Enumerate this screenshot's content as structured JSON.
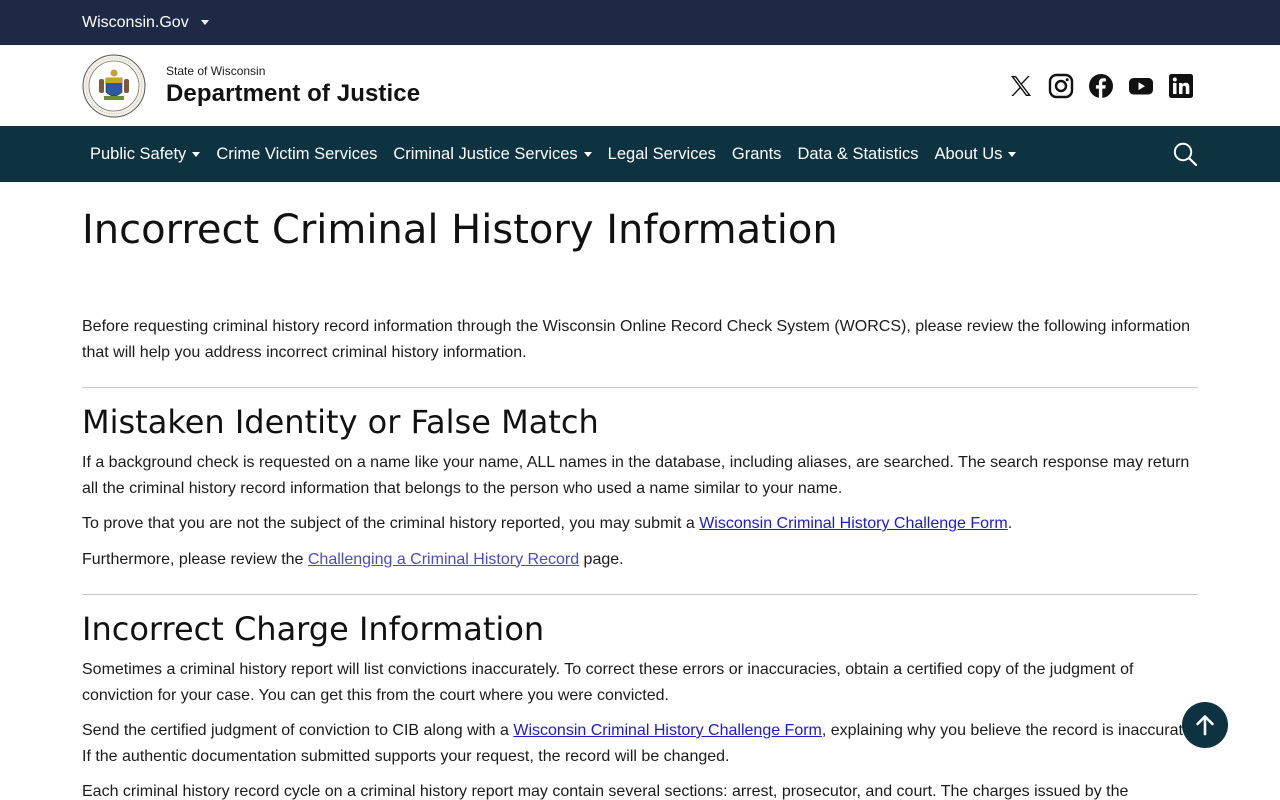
{
  "topbar": {
    "label": "Wisconsin.Gov"
  },
  "header": {
    "state": "State of Wisconsin",
    "department": "Department of Justice",
    "seal_alt": "Wisconsin Department of Justice seal",
    "social": [
      "x-icon",
      "instagram-icon",
      "facebook-icon",
      "youtube-icon",
      "linkedin-icon"
    ]
  },
  "nav": {
    "items": [
      {
        "label": "Public Safety",
        "dropdown": true
      },
      {
        "label": "Crime Victim Services",
        "dropdown": false
      },
      {
        "label": "Criminal Justice Services",
        "dropdown": true
      },
      {
        "label": "Legal Services",
        "dropdown": false
      },
      {
        "label": "Grants",
        "dropdown": false
      },
      {
        "label": "Data & Statistics",
        "dropdown": false
      },
      {
        "label": "About Us",
        "dropdown": true
      }
    ]
  },
  "page": {
    "title": "Incorrect Criminal History Information",
    "intro": "Before requesting criminal history record information through the Wisconsin Online Record Check System (WORCS), please review the following information that will help you address incorrect criminal history information.",
    "sections": [
      {
        "heading": "Mistaken Identity or False Match",
        "p1": "If a background check is requested on a name like your name, ALL names in the database, including aliases, are searched. The search response may return all the criminal history record information that belongs to the person who used a name similar to your name.",
        "p2_before": "To prove that you are not the subject of the criminal history reported, you may submit a ",
        "p2_link": "Wisconsin Criminal History Challenge Form",
        "p2_after": ".",
        "p3_before": "Furthermore, please review the ",
        "p3_link": "Challenging a Criminal History Record",
        "p3_after": " page."
      },
      {
        "heading": "Incorrect Charge Information",
        "p1": "Sometimes a criminal history report will list convictions inaccurately. To correct these errors or inaccuracies, obtain a certified copy of the judgment of conviction for your case. You can get this from the court where you were convicted.",
        "p2_before": "Send the certified judgment of conviction to CIB along with a ",
        "p2_link": "Wisconsin Criminal History Challenge Form",
        "p2_after": ", explaining why you believe the record is inaccurate. If the authentic documentation submitted supports your request, the record will be changed.",
        "p3": "Each criminal history record cycle on a criminal history report may contain several sections: arrest, prosecutor, and court. The charges issued by the"
      }
    ]
  },
  "colors": {
    "topbar": "#1e2a45",
    "navbar": "#0d3240",
    "link": "#1d19d8"
  }
}
